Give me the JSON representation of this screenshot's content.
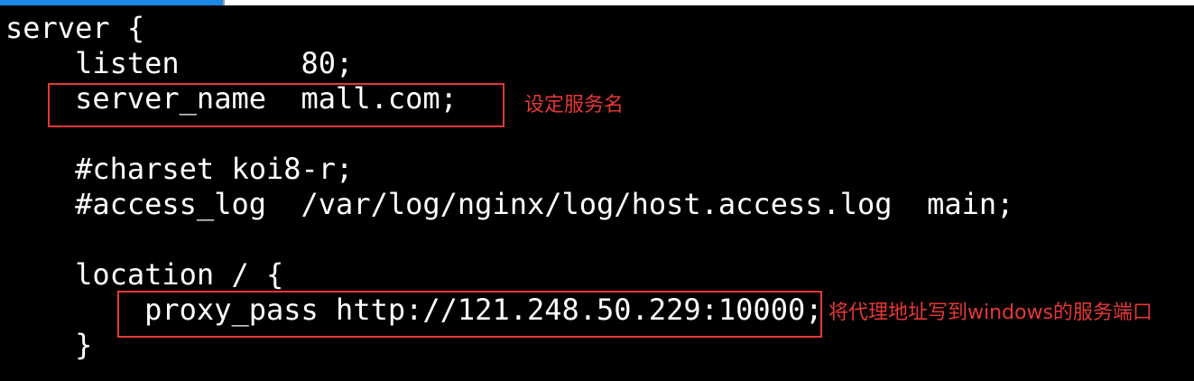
{
  "colors": {
    "background": "#000000",
    "text": "#ffffff",
    "highlight": "#e53935",
    "tab_accent": "#1e88e5"
  },
  "code_lines": [
    "server {",
    "    listen       80;",
    "    server_name  mall.com;",
    "",
    "    #charset koi8-r;",
    "    #access_log  /var/log/nginx/log/host.access.log  main;",
    "",
    "    location / {",
    "        proxy_pass http://121.248.50.229:10000;",
    "    }"
  ],
  "annotations": {
    "server_name_note": "设定服务名",
    "proxy_pass_note": "将代理地址写到windows的服务端口"
  }
}
